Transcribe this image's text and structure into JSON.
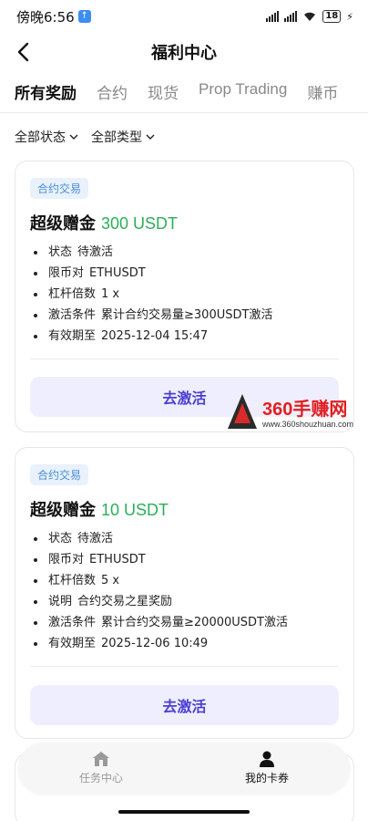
{
  "status_bar": {
    "time": "傍晚6:56",
    "battery": "18"
  },
  "nav": {
    "title": "福利中心"
  },
  "tabs": [
    {
      "label": "所有奖励",
      "active": true
    },
    {
      "label": "合约",
      "active": false
    },
    {
      "label": "现货",
      "active": false
    },
    {
      "label": "Prop Trading",
      "active": false
    },
    {
      "label": "赚币",
      "active": false
    }
  ],
  "filters": {
    "status": "全部状态",
    "type": "全部类型"
  },
  "cards": [
    {
      "tag": "合约交易",
      "title": "超级赠金",
      "amount": "300 USDT",
      "details": [
        {
          "key": "状态",
          "value": "待激活"
        },
        {
          "key": "限币对",
          "value": "ETHUSDT"
        },
        {
          "key": "杠杆倍数",
          "value": "1 x"
        },
        {
          "key": "激活条件",
          "value": "累计合约交易量≥300USDT激活"
        },
        {
          "key": "有效期至",
          "value": "2025-12-04 15:47"
        }
      ],
      "button": "去激活"
    },
    {
      "tag": "合约交易",
      "title": "超级赠金",
      "amount": "10 USDT",
      "details": [
        {
          "key": "状态",
          "value": "待激活"
        },
        {
          "key": "限币对",
          "value": "ETHUSDT"
        },
        {
          "key": "杠杆倍数",
          "value": "5 x"
        },
        {
          "key": "说明",
          "value": "合约交易之星奖励"
        },
        {
          "key": "激活条件",
          "value": "累计合约交易量≥20000USDT激活"
        },
        {
          "key": "有效期至",
          "value": "2025-12-06 10:49"
        }
      ],
      "button": "去激活"
    }
  ],
  "bottom_nav": [
    {
      "label": "任务中心",
      "icon": "home-icon",
      "active": false
    },
    {
      "label": "我的卡券",
      "icon": "user-icon",
      "active": true
    }
  ],
  "watermark": {
    "brand": "360手赚网",
    "url": "www.360shouzhuan.com"
  },
  "colors": {
    "accent": "#4b3fd1",
    "amount_green": "#2bae5b",
    "tag_blue": "#4a8fd6",
    "button_bg": "#efeefe"
  }
}
